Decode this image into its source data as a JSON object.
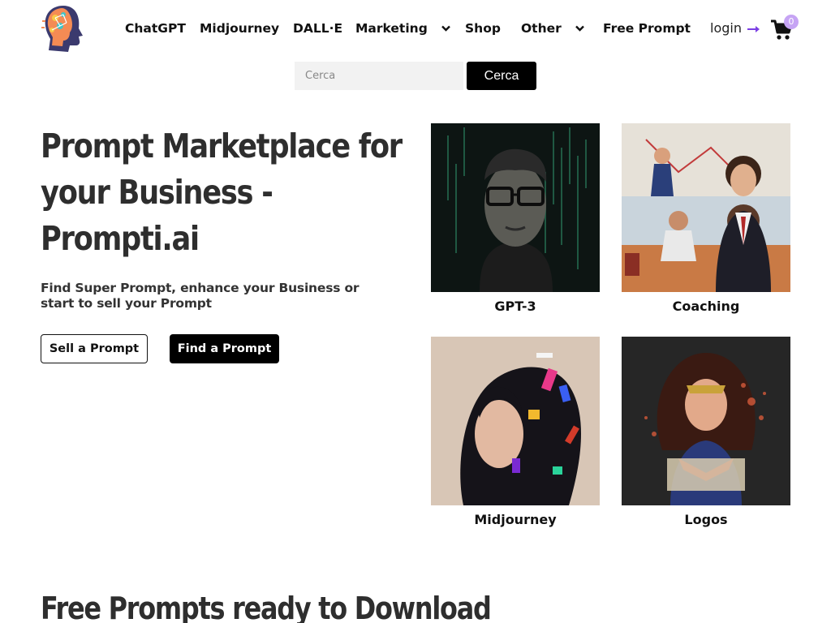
{
  "header": {
    "logo_icon": "ai-head-logo-icon",
    "nav": [
      {
        "label": "ChatGPT",
        "dropdown": false
      },
      {
        "label": "Midjourney",
        "dropdown": false
      },
      {
        "label": "DALL·E",
        "dropdown": false
      },
      {
        "label": "Marketing",
        "dropdown": true
      },
      {
        "label": "Shop",
        "dropdown": false
      },
      {
        "label": "Other",
        "dropdown": true
      },
      {
        "label": "Free Prompt",
        "dropdown": false
      }
    ],
    "login_label": "login",
    "login_icon": "arrow-right-icon",
    "cart_icon": "shopping-cart-icon",
    "cart_count": "0",
    "accent_color": "#7b3fe4"
  },
  "search": {
    "placeholder": "Cerca",
    "value": "",
    "button_label": "Cerca"
  },
  "hero": {
    "title": "Prompt Marketplace for your Business - Prompti.ai",
    "subtitle": "Find Super Prompt, enhance your Business or start to sell your Prompt",
    "sell_button": "Sell a Prompt",
    "find_button": "Find a Prompt"
  },
  "categories": [
    {
      "label": "GPT-3"
    },
    {
      "label": "Coaching"
    },
    {
      "label": "Midjourney"
    },
    {
      "label": "Logos"
    }
  ],
  "free_section": {
    "title": "Free Prompts ready to Download"
  }
}
